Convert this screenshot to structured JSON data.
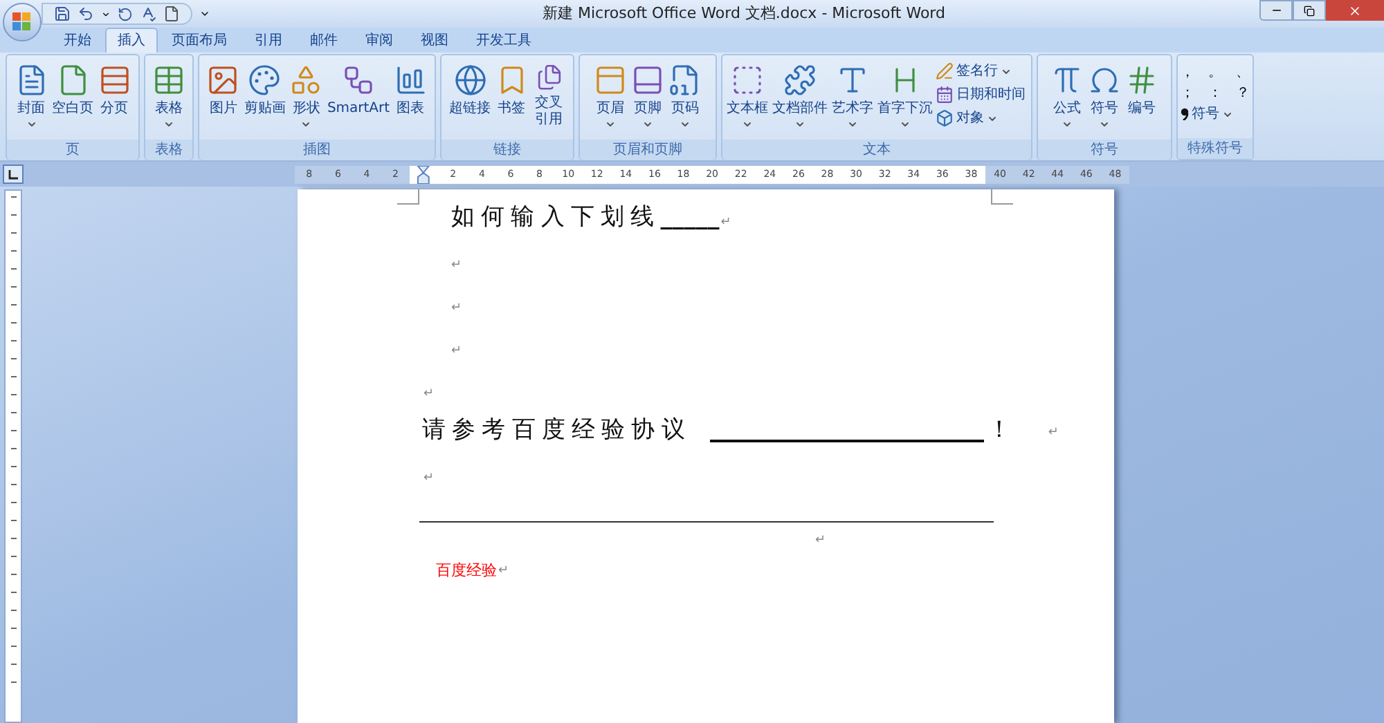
{
  "window": {
    "title": "新建 Microsoft Office Word 文档.docx - Microsoft Word"
  },
  "tabs": [
    {
      "label": "开始",
      "selected": false
    },
    {
      "label": "插入",
      "selected": true
    },
    {
      "label": "页面布局",
      "selected": false
    },
    {
      "label": "引用",
      "selected": false
    },
    {
      "label": "邮件",
      "selected": false
    },
    {
      "label": "审阅",
      "selected": false
    },
    {
      "label": "视图",
      "selected": false
    },
    {
      "label": "开发工具",
      "selected": false
    }
  ],
  "ribbon": {
    "groups": [
      {
        "label": "页",
        "items": [
          {
            "kind": "large",
            "label": "封面",
            "dropdown": true
          },
          {
            "kind": "large",
            "label": "空白页",
            "dropdown": false
          },
          {
            "kind": "large",
            "label": "分页",
            "dropdown": false
          }
        ]
      },
      {
        "label": "表格",
        "items": [
          {
            "kind": "large",
            "label": "表格",
            "dropdown": true
          }
        ]
      },
      {
        "label": "插图",
        "items": [
          {
            "kind": "large",
            "label": "图片",
            "dropdown": false
          },
          {
            "kind": "large",
            "label": "剪贴画",
            "dropdown": false
          },
          {
            "kind": "large",
            "label": "形状",
            "dropdown": true
          },
          {
            "kind": "large",
            "label": "SmartArt",
            "dropdown": false
          },
          {
            "kind": "large",
            "label": "图表",
            "dropdown": false
          }
        ]
      },
      {
        "label": "链接",
        "items": [
          {
            "kind": "large",
            "label": "超链接",
            "dropdown": false
          },
          {
            "kind": "large",
            "label": "书签",
            "dropdown": false
          },
          {
            "kind": "large",
            "label": "交叉引用",
            "dropdown": false
          }
        ]
      },
      {
        "label": "页眉和页脚",
        "items": [
          {
            "kind": "large",
            "label": "页眉",
            "dropdown": true
          },
          {
            "kind": "large",
            "label": "页脚",
            "dropdown": true
          },
          {
            "kind": "large",
            "label": "页码",
            "dropdown": true
          }
        ]
      },
      {
        "label": "文本",
        "items": [
          {
            "kind": "large",
            "label": "文本框",
            "dropdown": true
          },
          {
            "kind": "large",
            "label": "文档部件",
            "dropdown": true
          },
          {
            "kind": "large",
            "label": "艺术字",
            "dropdown": true
          },
          {
            "kind": "large",
            "label": "首字下沉",
            "dropdown": true
          },
          {
            "kind": "small",
            "label": "签名行",
            "dropdown": true
          },
          {
            "kind": "small",
            "label": "日期和时间",
            "dropdown": false
          },
          {
            "kind": "small",
            "label": "对象",
            "dropdown": true
          }
        ]
      },
      {
        "label": "符号",
        "items": [
          {
            "kind": "large",
            "label": "公式",
            "dropdown": true
          },
          {
            "kind": "large",
            "label": "符号",
            "dropdown": true
          },
          {
            "kind": "large",
            "label": "编号",
            "dropdown": false
          }
        ]
      },
      {
        "label": "特殊符号",
        "items": [
          {
            "kind": "symbols",
            "symbols": [
              "，",
              "。",
              "、",
              "；",
              "：",
              "？"
            ]
          },
          {
            "kind": "small",
            "label": "符号",
            "dropdown": true
          }
        ]
      }
    ]
  },
  "ruler": {
    "ticks": [
      {
        "label": "8",
        "in_margin": true
      },
      {
        "label": "6",
        "in_margin": true
      },
      {
        "label": "4",
        "in_margin": true
      },
      {
        "label": "2",
        "in_margin": true
      },
      {
        "kind": "indent"
      },
      {
        "label": "2",
        "in_margin": false
      },
      {
        "label": "4",
        "in_margin": false
      },
      {
        "label": "6",
        "in_margin": false
      },
      {
        "label": "8",
        "in_margin": false
      },
      {
        "label": "10",
        "in_margin": false
      },
      {
        "label": "12",
        "in_margin": false
      },
      {
        "label": "14",
        "in_margin": false
      },
      {
        "label": "16",
        "in_margin": false
      },
      {
        "label": "18",
        "in_margin": false
      },
      {
        "label": "20",
        "in_margin": false
      },
      {
        "label": "22",
        "in_margin": false
      },
      {
        "label": "24",
        "in_margin": false
      },
      {
        "label": "26",
        "in_margin": false
      },
      {
        "label": "28",
        "in_margin": false
      },
      {
        "label": "30",
        "in_margin": false
      },
      {
        "label": "32",
        "in_margin": false
      },
      {
        "label": "34",
        "in_margin": false
      },
      {
        "label": "36",
        "in_margin": false
      },
      {
        "label": "38",
        "in_margin": false
      },
      {
        "label": "40",
        "in_margin": true
      },
      {
        "label": "42",
        "in_margin": true
      },
      {
        "label": "44",
        "in_margin": true
      },
      {
        "label": "46",
        "in_margin": true
      },
      {
        "label": "48",
        "in_margin": true
      }
    ]
  },
  "document": {
    "paragraphs": [
      {
        "kind": "heading",
        "text": "如何输入下划线",
        "underscores": "_____",
        "mark": "↵"
      },
      {
        "kind": "indented_empty",
        "mark": "↵"
      },
      {
        "kind": "indented_empty",
        "mark": "↵"
      },
      {
        "kind": "indented_empty",
        "mark": "↵"
      },
      {
        "kind": "empty",
        "mark": "↵"
      },
      {
        "kind": "blank_line",
        "text": "请参考百度经验协议",
        "suffix": "！",
        "mark": "↵"
      },
      {
        "kind": "empty",
        "mark": "↵"
      },
      {
        "kind": "rule"
      },
      {
        "kind": "centered_mark",
        "mark": "↵"
      },
      {
        "kind": "note",
        "text": "百度经验",
        "color": "#ff0000",
        "mark": "↵"
      }
    ]
  }
}
